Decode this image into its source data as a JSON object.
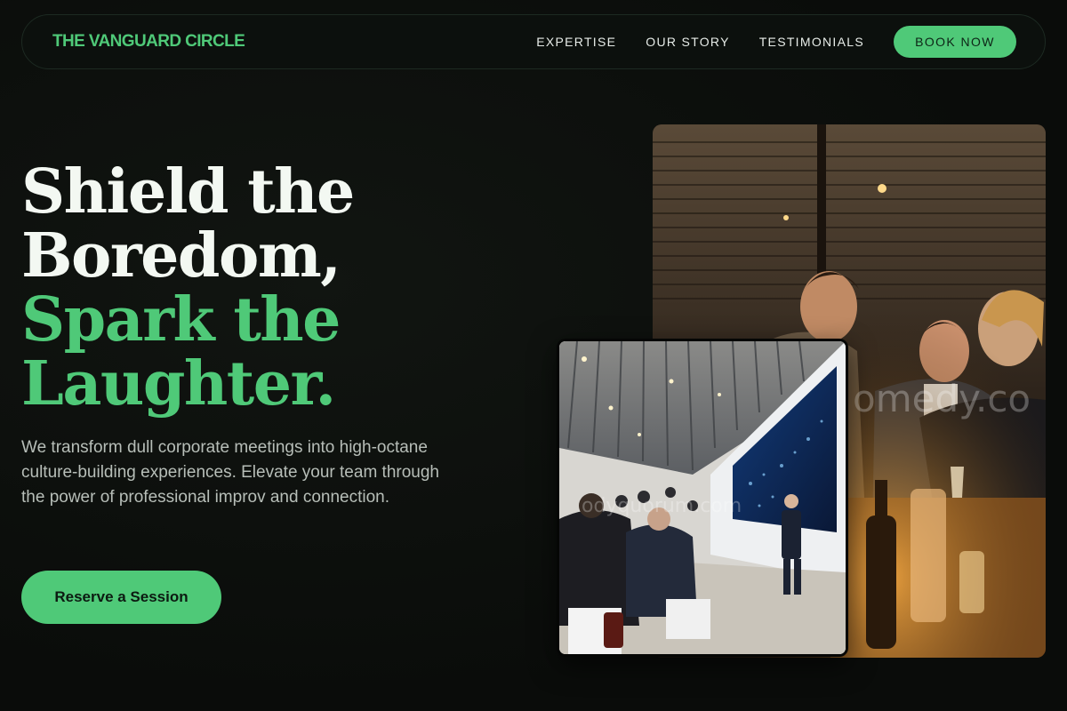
{
  "nav": {
    "brand": "THE VANGUARD CIRCLE",
    "links": [
      "EXPERTISE",
      "OUR STORY",
      "TESTIMONIALS"
    ],
    "cta": "BOOK NOW"
  },
  "hero": {
    "headline_white": [
      "Shield the",
      "Boredom,"
    ],
    "headline_green": [
      "Spark the",
      "Laughter."
    ],
    "lead": "We transform dull corporate meetings into high-octane culture-building experiences. Elevate your team through the power of professional improv and connection.",
    "cta": "Reserve a Session"
  },
  "images": {
    "back_watermark": "omedy.co",
    "front_watermark": "odyquorum.com"
  },
  "colors": {
    "accent": "#4fc978",
    "background": "#0b0d0b",
    "headline": "#f3f8f2",
    "body_text": "#b7beb8"
  }
}
